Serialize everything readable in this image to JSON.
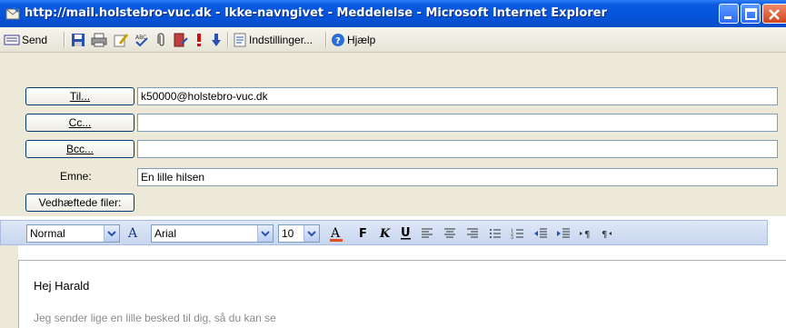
{
  "window": {
    "title": "http://mail.holstebro-vuc.dk - Ikke-navngivet - Meddelelse - Microsoft Internet Explorer"
  },
  "toolbar": {
    "send_label": "Send",
    "options_label": "Indstillinger...",
    "help_label": "Hjælp"
  },
  "form": {
    "to_button": "Til...",
    "cc_button": "Cc...",
    "bcc_button": "Bcc...",
    "subject_label": "Emne:",
    "attachments_button": "Vedhæftede filer:",
    "to_value": "k50000@holstebro-vuc.dk",
    "cc_value": "",
    "bcc_value": "",
    "subject_value": "En lille hilsen"
  },
  "format": {
    "style": "Normal",
    "font": "Arial",
    "size": "10"
  },
  "body": {
    "greeting": "Hej Harald",
    "text": "Jeg sender lige en lille besked til dig, så du kan se"
  }
}
